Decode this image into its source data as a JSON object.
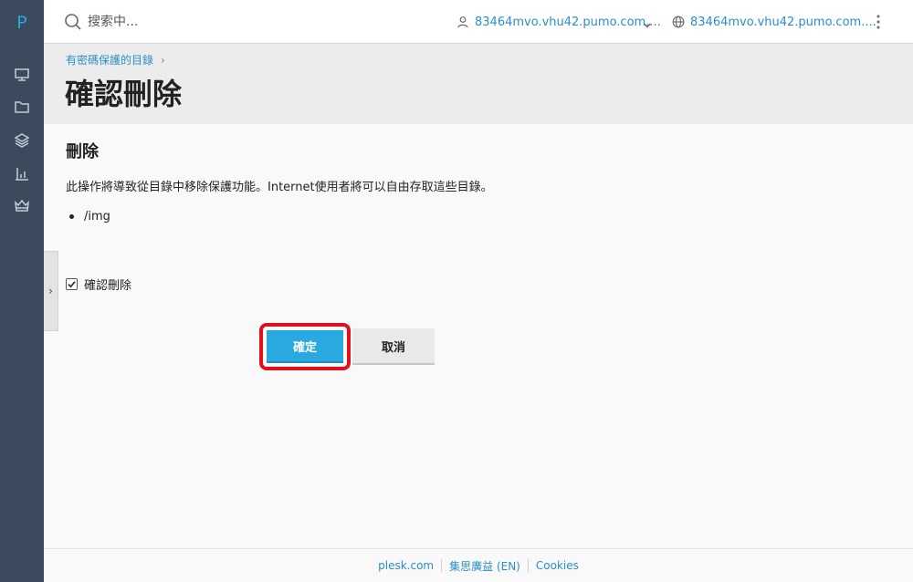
{
  "nav": {
    "logo": "P",
    "icons": [
      "monitor-icon",
      "folder-icon",
      "layers-icon",
      "bar-chart-icon",
      "crown-icon"
    ]
  },
  "topbar": {
    "search_placeholder": "搜索中...",
    "user_label": "83464mvo.vhu42.pumo.com....",
    "domain_label": "83464mvo.vhu42.pumo.com...."
  },
  "header": {
    "breadcrumb": "有密碼保護的目錄",
    "title": "確認刪除"
  },
  "main": {
    "section_title": "刪除",
    "description": "此操作將導致從目錄中移除保護功能。Internet使用者將可以自由存取這些目錄。",
    "items": [
      "/img"
    ],
    "confirm_label": "確認刪除",
    "confirm_checked": true,
    "ok_label": "確定",
    "cancel_label": "取消"
  },
  "footer": {
    "links": [
      "plesk.com",
      "集思廣益 (EN)",
      "Cookies"
    ]
  },
  "colors": {
    "accent": "#29a9e0",
    "link": "#2a8fc8",
    "nav_bg": "#3b4a5c",
    "highlight": "#e0101e"
  }
}
